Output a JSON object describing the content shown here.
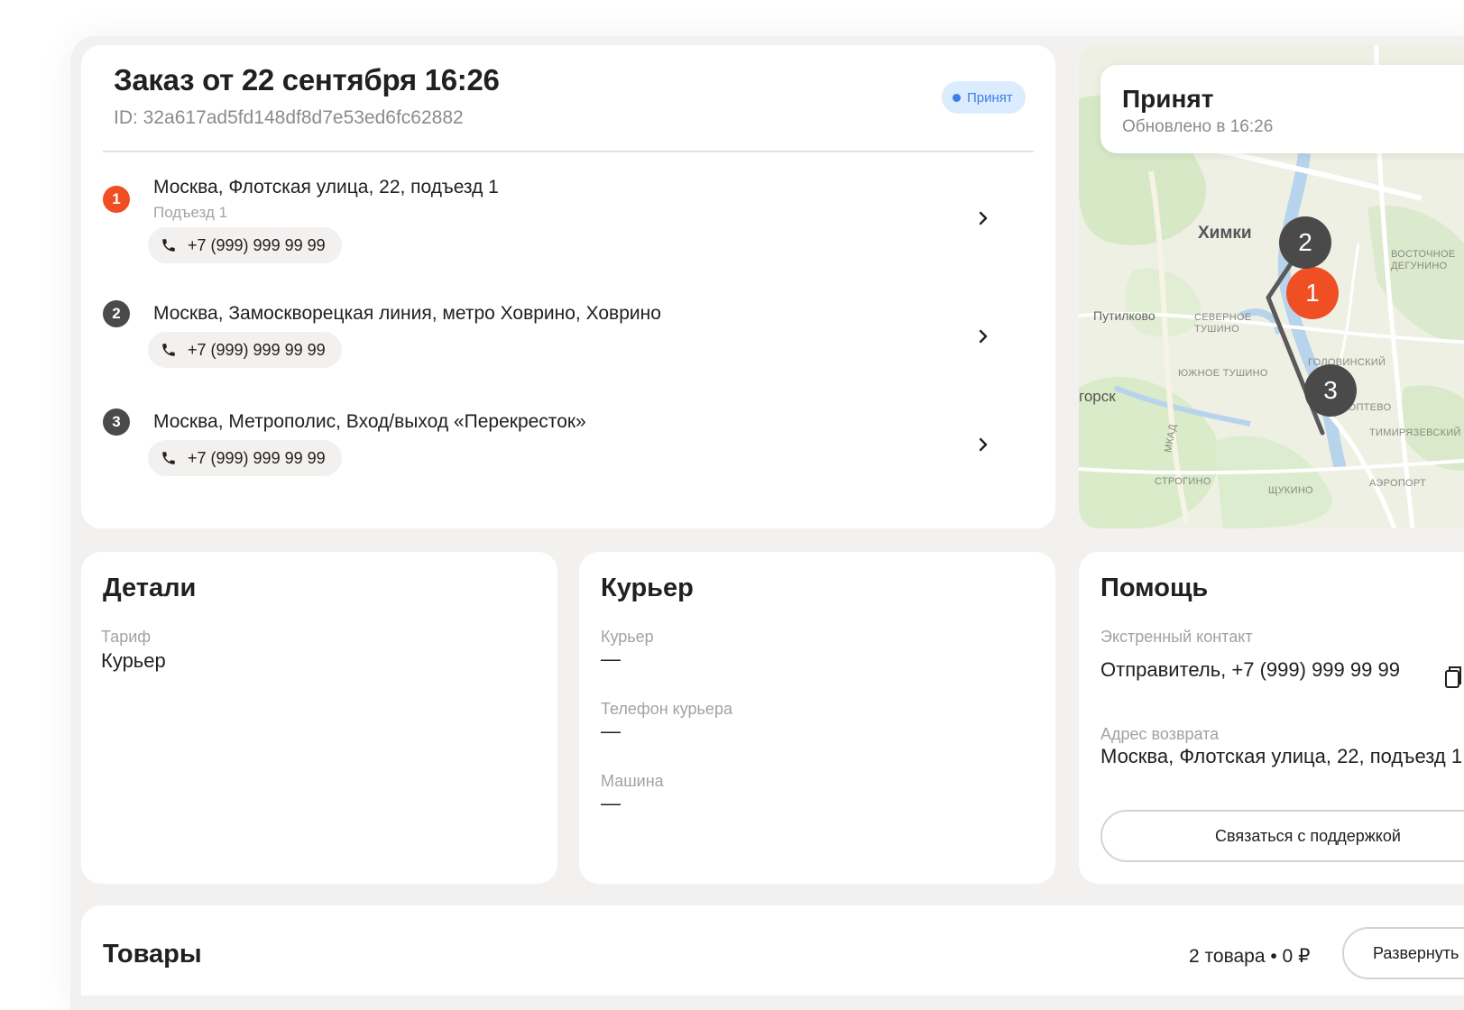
{
  "order": {
    "title": "Заказ от  22 сентября 16:26",
    "id_text": "ID: 32a617ad5fd148df8d7e53ed6fc62882",
    "status_badge": "Принят",
    "stops": [
      {
        "number": "1",
        "address": "Москва, Флотская улица, 22, подъезд 1",
        "note": "Подъезд 1",
        "phone": "+7 (999) 999 99 99"
      },
      {
        "number": "2",
        "address": "Москва, Замоскворецкая линия, метро Ховрино, Ховрино",
        "phone": "+7 (999) 999 99 99"
      },
      {
        "number": "3",
        "address": "Москва, Метрополис, Вход/выход «Перекресток»",
        "phone": "+7 (999) 999 99 99"
      }
    ]
  },
  "map": {
    "status_title": "Принят",
    "status_updated": "Обновлено в 16:26",
    "labels": {
      "khimki": "Химки",
      "putilkovo": "Путилково",
      "sev_tushino": "СЕВЕРНОЕ ТУШИНО",
      "yuzh_tushino": "ЮЖНОЕ ТУШИНО",
      "golovinsky": "ГОЛОВИНСКИЙ",
      "koptevo": "КОПТЕВО",
      "timiryazevsky": "ТИМИРЯЗЕВСКИЙ",
      "strogino": "СТРОГИНО",
      "shchukino": "ЩУКИНО",
      "aeroport": "АЭРОПОРТ",
      "vostochnoe": "ВОСТОЧНОЕ ДЕГУНИНО",
      "gorsk": "горск",
      "mkad": "МКАД"
    },
    "markers": [
      "1",
      "2",
      "3"
    ],
    "colors": {
      "active": "#f04e23",
      "inactive": "#4a4a4a",
      "route": "#5a5a5a"
    }
  },
  "details": {
    "title": "Детали",
    "tariff_label": "Тариф",
    "tariff_value": "Курьер"
  },
  "courier": {
    "title": "Курьер",
    "courier_label": "Курьер",
    "courier_value": "—",
    "phone_label": "Телефон курьера",
    "phone_value": "—",
    "car_label": "Машина",
    "car_value": "—"
  },
  "help": {
    "title": "Помощь",
    "emergency_label": "Экстренный контакт",
    "emergency_value": "Отправитель, +7 (999) 999 99 99",
    "return_label": "Адрес возврата",
    "return_value": "Москва, Флотская улица, 22, подъезд 1",
    "support_button": "Связаться с поддержкой"
  },
  "goods": {
    "title": "Товары",
    "summary": "2 товара • 0 ₽",
    "expand_button": "Развернуть"
  }
}
